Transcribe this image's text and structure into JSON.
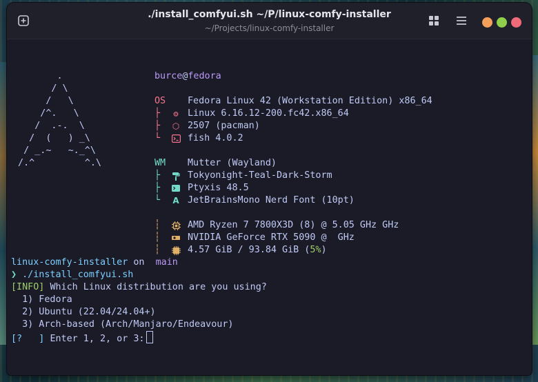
{
  "window": {
    "title": "./install_comfyui.sh ~/P/linux-comfy-installer",
    "subtitle": "~/Projects/linux-comfy-installer"
  },
  "icons": {
    "new_tab": "plus-square-icon",
    "grid": "grid-icon",
    "menu": "hamburger-menu-icon"
  },
  "colors": {
    "background": "#1a1b26",
    "text": "#c0caf5",
    "purple": "#bb9af7",
    "red": "#f7768e",
    "green": "#73daca",
    "yellow": "#e0af68",
    "cyan": "#7dcfff",
    "minimize": "#f5a05a",
    "maximize": "#8fcf4a",
    "close": "#f06a78"
  },
  "fetch": {
    "user": "burce",
    "at": "@",
    "host": "fedora",
    "logo": [
      "        .",
      "       / \\",
      "      /   \\",
      "     /^.   \\",
      "    /  .-.  \\",
      "   /  (   ) _\\",
      "  / _.~   ~._^\\",
      " /.^         ^.\\"
    ],
    "os_label": "OS",
    "os_value": "Fedora Linux 42 (Workstation Edition) x86_64",
    "kernel": "Linux 6.16.12-200.fc42.x86_64",
    "packages": "2507 (pacman)",
    "shell": "fish 4.0.2",
    "wm_label": "WM",
    "wm_value": "Mutter (Wayland)",
    "theme": "Tokyonight-Teal-Dark-Storm",
    "terminal": "Ptyxis 48.5",
    "font": "JetBrainsMono Nerd Font (10pt)",
    "cpu": "AMD Ryzen 7 7800X3D (8) @ 5.05 GHz GHz",
    "gpu": "NVIDIA GeForce RTX 5090 @  GHz",
    "memory_prefix": "4.57 GiB / 93.84 GiB (",
    "memory_percent": "5%",
    "memory_suffix": ")"
  },
  "prompt": {
    "dir": "linux-comfy-installer",
    "on": "on",
    "branch_icon": "",
    "branch": "main",
    "arrow": "❯",
    "command": "./install_comfyui.sh"
  },
  "output": {
    "info_tag": "[INFO]",
    "question": "Which Linux distribution are you using?",
    "options": [
      "1) Fedora",
      "2) Ubuntu (22.04/24.04+)",
      "3) Arch-based (Arch/Manjaro/Endeavour)"
    ],
    "input_tag": "[?   ]",
    "input_prompt": "Enter 1, 2, or 3:"
  }
}
